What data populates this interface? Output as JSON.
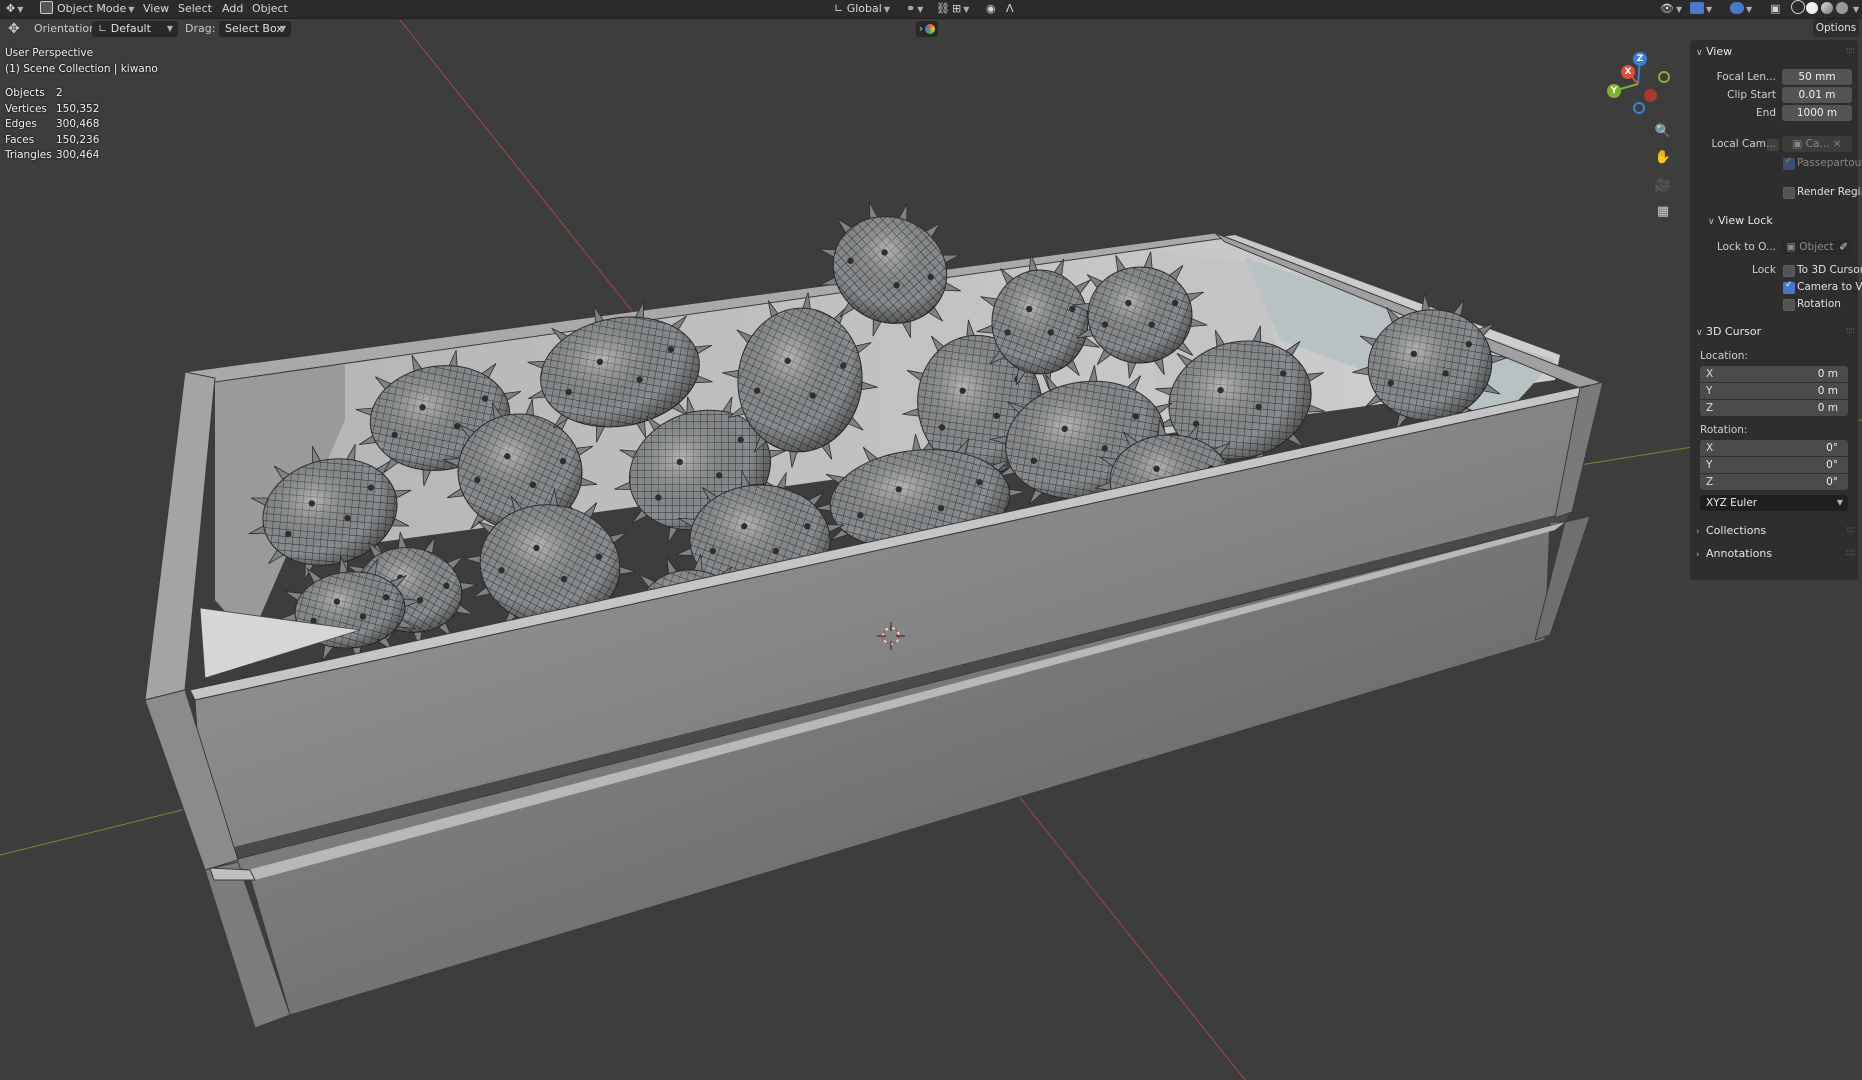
{
  "header": {
    "mode": "Object Mode",
    "menus": [
      "View",
      "Select",
      "Add",
      "Object"
    ],
    "transform_orientation": "Global",
    "colors": {
      "bg": "#2b2b2b",
      "accent": "#4a78c8"
    }
  },
  "tool_settings": {
    "orientation_label": "Orientation:",
    "orientation_value": "Default",
    "drag_label": "Drag:",
    "drag_value": "Select Box",
    "options": "Options"
  },
  "viewport": {
    "perspective": "User Perspective",
    "collection": "(1) Scene Collection | kiwano",
    "stats": [
      {
        "label": "Objects",
        "value": "2"
      },
      {
        "label": "Vertices",
        "value": "150,352"
      },
      {
        "label": "Edges",
        "value": "300,468"
      },
      {
        "label": "Faces",
        "value": "150,236"
      },
      {
        "label": "Triangles",
        "value": "300,464"
      }
    ],
    "gizmo": {
      "x": "X",
      "y": "Y",
      "z": "Z"
    },
    "icons": [
      "zoom-icon",
      "hand-pan-icon",
      "camera-view-icon",
      "ortho-grid-icon"
    ]
  },
  "npanel": {
    "view": {
      "title": "View",
      "focal_label": "Focal Len...",
      "focal_value": "50 mm",
      "clip_start_label": "Clip Start",
      "clip_start_value": "0.01 m",
      "end_label": "End",
      "end_value": "1000 m",
      "local_cam_label": "Local Cam...",
      "local_cam_value": "Ca...",
      "passepartout": "Passepartout",
      "render_region": "Render Regi..."
    },
    "view_lock": {
      "title": "View Lock",
      "lock_to_label": "Lock to O...",
      "lock_to_value": "Object",
      "lock_label": "Lock",
      "to_3d_cursor": "To 3D Cursor",
      "camera_to_view": "Camera to Vi...",
      "rotation": "Rotation"
    },
    "cursor": {
      "title": "3D Cursor",
      "location_label": "Location:",
      "loc": [
        {
          "axis": "X",
          "value": "0 m"
        },
        {
          "axis": "Y",
          "value": "0 m"
        },
        {
          "axis": "Z",
          "value": "0 m"
        }
      ],
      "rotation_label": "Rotation:",
      "rot": [
        {
          "axis": "X",
          "value": "0°"
        },
        {
          "axis": "Y",
          "value": "0°"
        },
        {
          "axis": "Z",
          "value": "0°"
        }
      ],
      "rotation_mode": "XYZ Euler"
    },
    "collections": "Collections",
    "annotations": "Annotations"
  }
}
